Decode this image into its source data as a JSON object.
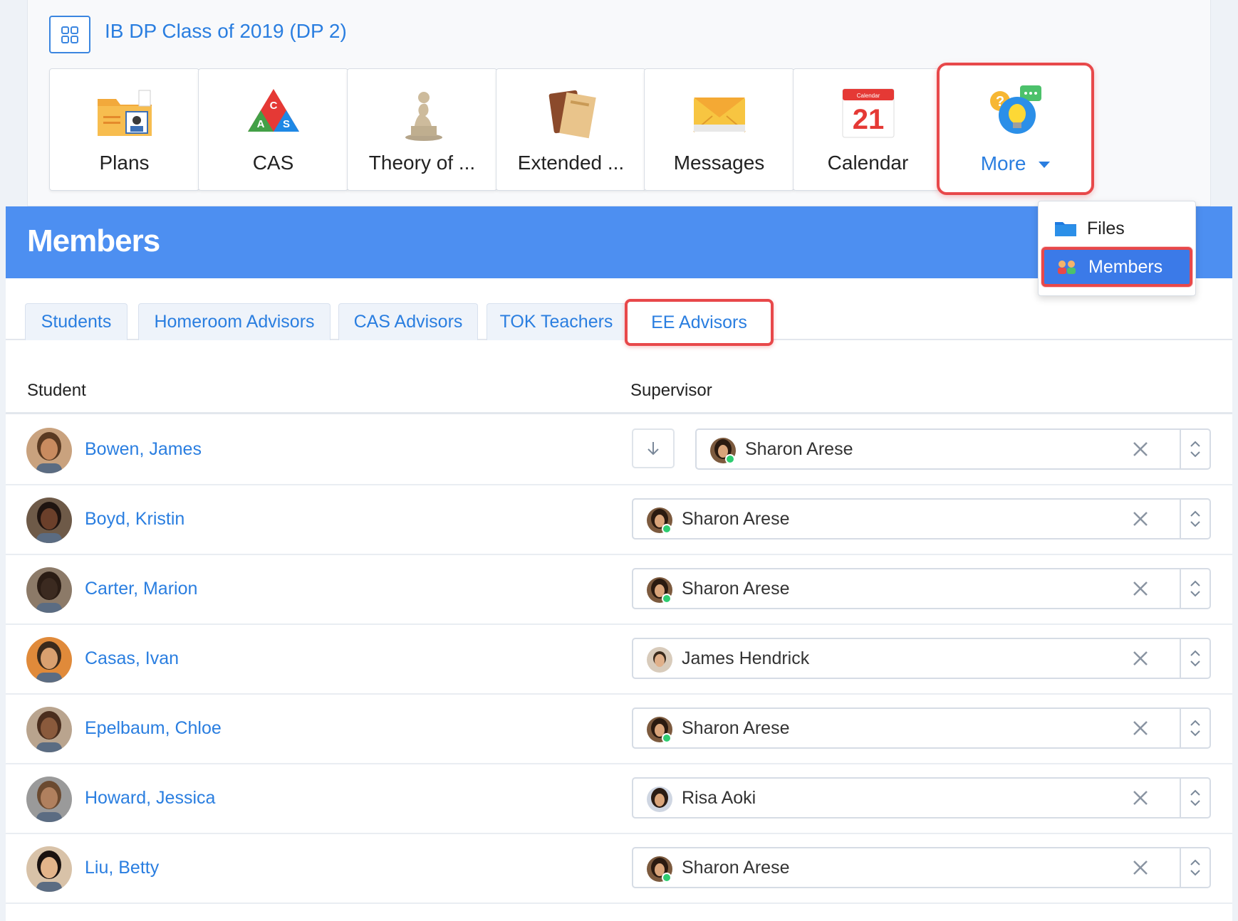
{
  "header": {
    "title": "IB DP Class of 2019 (DP 2)"
  },
  "tiles": [
    {
      "label": "Plans",
      "icon": "plans-folder-icon"
    },
    {
      "label": "CAS",
      "icon": "cas-triangle-icon"
    },
    {
      "label": "Theory of ...",
      "icon": "thinker-statue-icon"
    },
    {
      "label": "Extended ...",
      "icon": "essay-book-icon"
    },
    {
      "label": "Messages",
      "icon": "envelope-icon"
    },
    {
      "label": "Calendar",
      "icon": "calendar-icon",
      "calendar_top": "Calendar",
      "calendar_day": "21"
    },
    {
      "label": "More",
      "icon": "lightbulb-chat-icon"
    }
  ],
  "dropdown": {
    "files": "Files",
    "members": "Members"
  },
  "page": {
    "title": "Members"
  },
  "tabs": [
    "Students",
    "Homeroom Advisors",
    "CAS Advisors",
    "TOK Teachers",
    "EE Advisors"
  ],
  "table": {
    "col_student": "Student",
    "col_supervisor": "Supervisor",
    "rows": [
      {
        "student": "Bowen, James",
        "supervisor": "Sharon Arese"
      },
      {
        "student": "Boyd, Kristin",
        "supervisor": "Sharon Arese"
      },
      {
        "student": "Carter, Marion",
        "supervisor": "Sharon Arese"
      },
      {
        "student": "Casas, Ivan",
        "supervisor": "James Hendrick"
      },
      {
        "student": "Epelbaum, Chloe",
        "supervisor": "Sharon Arese"
      },
      {
        "student": "Howard, Jessica",
        "supervisor": "Risa Aoki"
      },
      {
        "student": "Liu, Betty",
        "supervisor": "Sharon Arese"
      }
    ]
  },
  "colors": {
    "accent": "#2a7ee0",
    "header_bar": "#4d8ff1",
    "highlight": "#e8484a",
    "online": "#2ecc71"
  }
}
